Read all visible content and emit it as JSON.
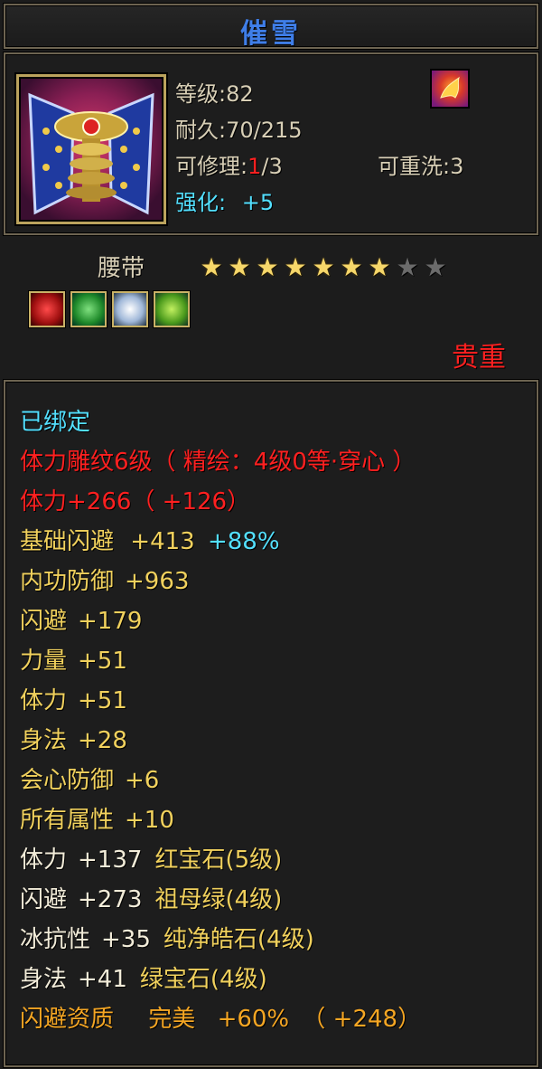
{
  "item": {
    "name": "催雪",
    "level_label": "等级",
    "level_value": ":82",
    "durability_label": "耐久",
    "durability_value": ":70/215",
    "repair_label": "可修理",
    "repair_colon": ":",
    "repair_used": "1",
    "repair_total": "/3",
    "rewash_label": "可重洗",
    "rewash_value": ":3",
    "enhance_label": "强化:",
    "enhance_value": "+5",
    "type": "腰带",
    "rarity": "贵重",
    "stars_total": 9,
    "stars_filled": 7,
    "gems": [
      "ruby-gem-icon",
      "emerald-gem-icon",
      "diamond-gem-icon",
      "green-gem-icon"
    ]
  },
  "colors": {
    "title": "#3f7ee8",
    "stat_normal": "#f1d15d",
    "stat_red": "#ff2020",
    "stat_cyan": "#53e0ff",
    "stat_orange": "#f5a623"
  },
  "stats": {
    "bound": "已绑定",
    "engrave": "体力雕纹6级（ 精绘：4级0等·穿心 ）",
    "vitality_main": "体力+266（ +126）",
    "base_dodge_label": "基础闪避",
    "base_dodge_value": "+413",
    "base_dodge_pct": "+88%",
    "lines": [
      {
        "label": "内功防御",
        "value": "+963"
      },
      {
        "label": "闪避",
        "value": "+179"
      },
      {
        "label": "力量",
        "value": "+51"
      },
      {
        "label": "体力",
        "value": "+51"
      },
      {
        "label": "身法",
        "value": "+28"
      },
      {
        "label": "会心防御",
        "value": "+6"
      },
      {
        "label": "所有属性",
        "value": "+10"
      }
    ],
    "gem_lines": [
      {
        "label": "体力",
        "value": "+137",
        "gem": "红宝石",
        "level": "(5级)"
      },
      {
        "label": "闪避",
        "value": "+273",
        "gem": "祖母绿",
        "level": "(4级)"
      },
      {
        "label": "冰抗性",
        "value": "+35",
        "gem": "纯净皓石",
        "level": "(4级)"
      },
      {
        "label": "身法",
        "value": "+41",
        "gem": "绿宝石",
        "level": "(4级)"
      }
    ],
    "quality_label": "闪避资质",
    "quality_grade": "完美",
    "quality_pct": "+60%",
    "quality_extra": "（ +248）"
  }
}
